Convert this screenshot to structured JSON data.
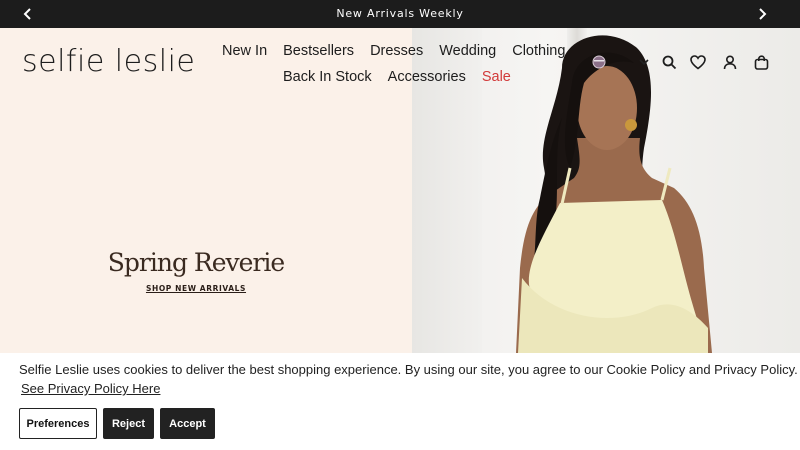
{
  "announcement": {
    "message": "New Arrivals Weekly",
    "prev_icon": "chevron-left-icon",
    "next_icon": "chevron-right-icon"
  },
  "header": {
    "logo": "selfie leslie",
    "nav_row1": [
      "New In",
      "Bestsellers",
      "Dresses",
      "Wedding",
      "Clothing"
    ],
    "nav_row2": [
      "Back In Stock",
      "Accessories",
      "Sale"
    ],
    "sale_color": "#d23a3a",
    "tools": [
      "currency-flag-icon",
      "chevron-down-icon",
      "search-icon",
      "heart-icon",
      "account-icon",
      "bag-icon"
    ]
  },
  "hero": {
    "headline": "Spring Reverie",
    "cta": "SHOP NEW ARRIVALS",
    "background_color": "#fbf1e9"
  },
  "cookie_banner": {
    "message": "Selfie Leslie uses cookies to deliver the best shopping experience. By using our site, you agree to our Cookie Policy and Privacy Policy.",
    "policy_link": "See Privacy Policy Here",
    "buttons": {
      "preferences": "Preferences",
      "reject": "Reject",
      "accept": "Accept"
    }
  }
}
